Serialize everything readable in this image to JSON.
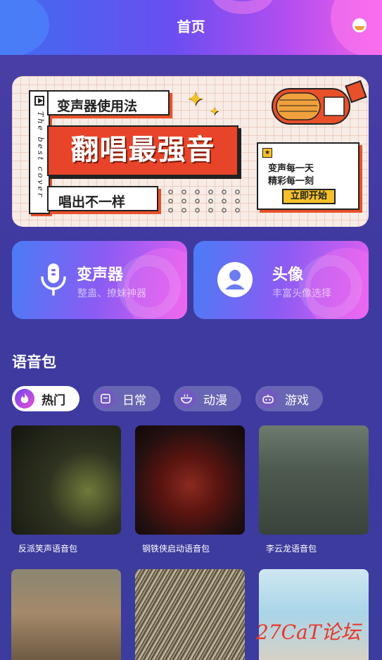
{
  "header": {
    "title": "首页",
    "gradient_colors": [
      "#3f6cf0",
      "#b24ef0",
      "#f060e8"
    ]
  },
  "banner": {
    "side_text": "The best cover",
    "tag1": "变声器使用法",
    "main": "翻唱最强音",
    "tag2": "唱出不一样",
    "card_line1": "变声每一天",
    "card_line2": "精彩每一刻",
    "card_button": "立即开始",
    "accent": "#e8442a"
  },
  "features": [
    {
      "name": "变声器",
      "sub": "整蛊、撩妹神器",
      "icon": "microphone-icon"
    },
    {
      "name": "头像",
      "sub": "丰富头像选择",
      "icon": "user-avatar-icon"
    }
  ],
  "voice_pack": {
    "title": "语音包",
    "tabs": [
      {
        "label": "热门",
        "icon": "fire-icon",
        "active": true
      },
      {
        "label": "日常",
        "icon": "calendar-icon",
        "active": false
      },
      {
        "label": "动漫",
        "icon": "bowl-icon",
        "active": false
      },
      {
        "label": "游戏",
        "icon": "gamepad-icon",
        "active": false
      }
    ],
    "items": [
      {
        "caption": "反派笑声语音包"
      },
      {
        "caption": "钢铁侠启动语音包"
      },
      {
        "caption": "李云龙语音包"
      },
      {
        "caption": ""
      },
      {
        "caption": ""
      },
      {
        "caption": ""
      }
    ]
  },
  "watermark": "27CaT论坛"
}
